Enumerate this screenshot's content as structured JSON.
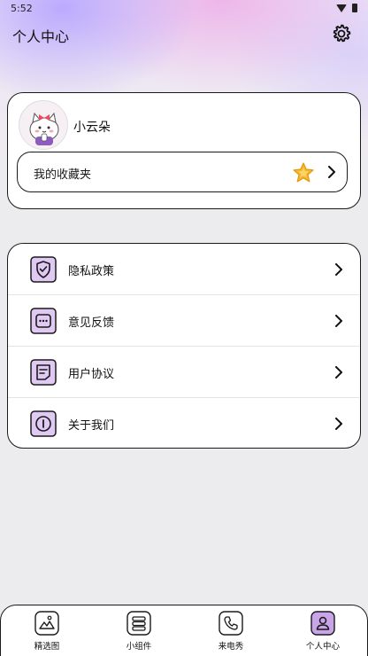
{
  "status_bar": {
    "time": "5:52"
  },
  "header": {
    "title": "个人中心"
  },
  "profile": {
    "nickname": "小云朵",
    "favorites_label": "我的收藏夹"
  },
  "menu": {
    "items": [
      {
        "label": "隐私政策",
        "icon": "shield-check-icon"
      },
      {
        "label": "意见反馈",
        "icon": "feedback-icon"
      },
      {
        "label": "用户协议",
        "icon": "document-icon"
      },
      {
        "label": "关于我们",
        "icon": "info-icon"
      }
    ]
  },
  "tabs": [
    {
      "label": "精选图",
      "icon": "image-icon"
    },
    {
      "label": "小组件",
      "icon": "widget-icon"
    },
    {
      "label": "来电秀",
      "icon": "phone-icon"
    },
    {
      "label": "个人中心",
      "icon": "user-icon",
      "active": true
    }
  ],
  "colors": {
    "accent": "#c9a4e8",
    "accent_light": "#e0c9f2",
    "outline": "#1a1a1a",
    "star": "#f5b82a"
  }
}
